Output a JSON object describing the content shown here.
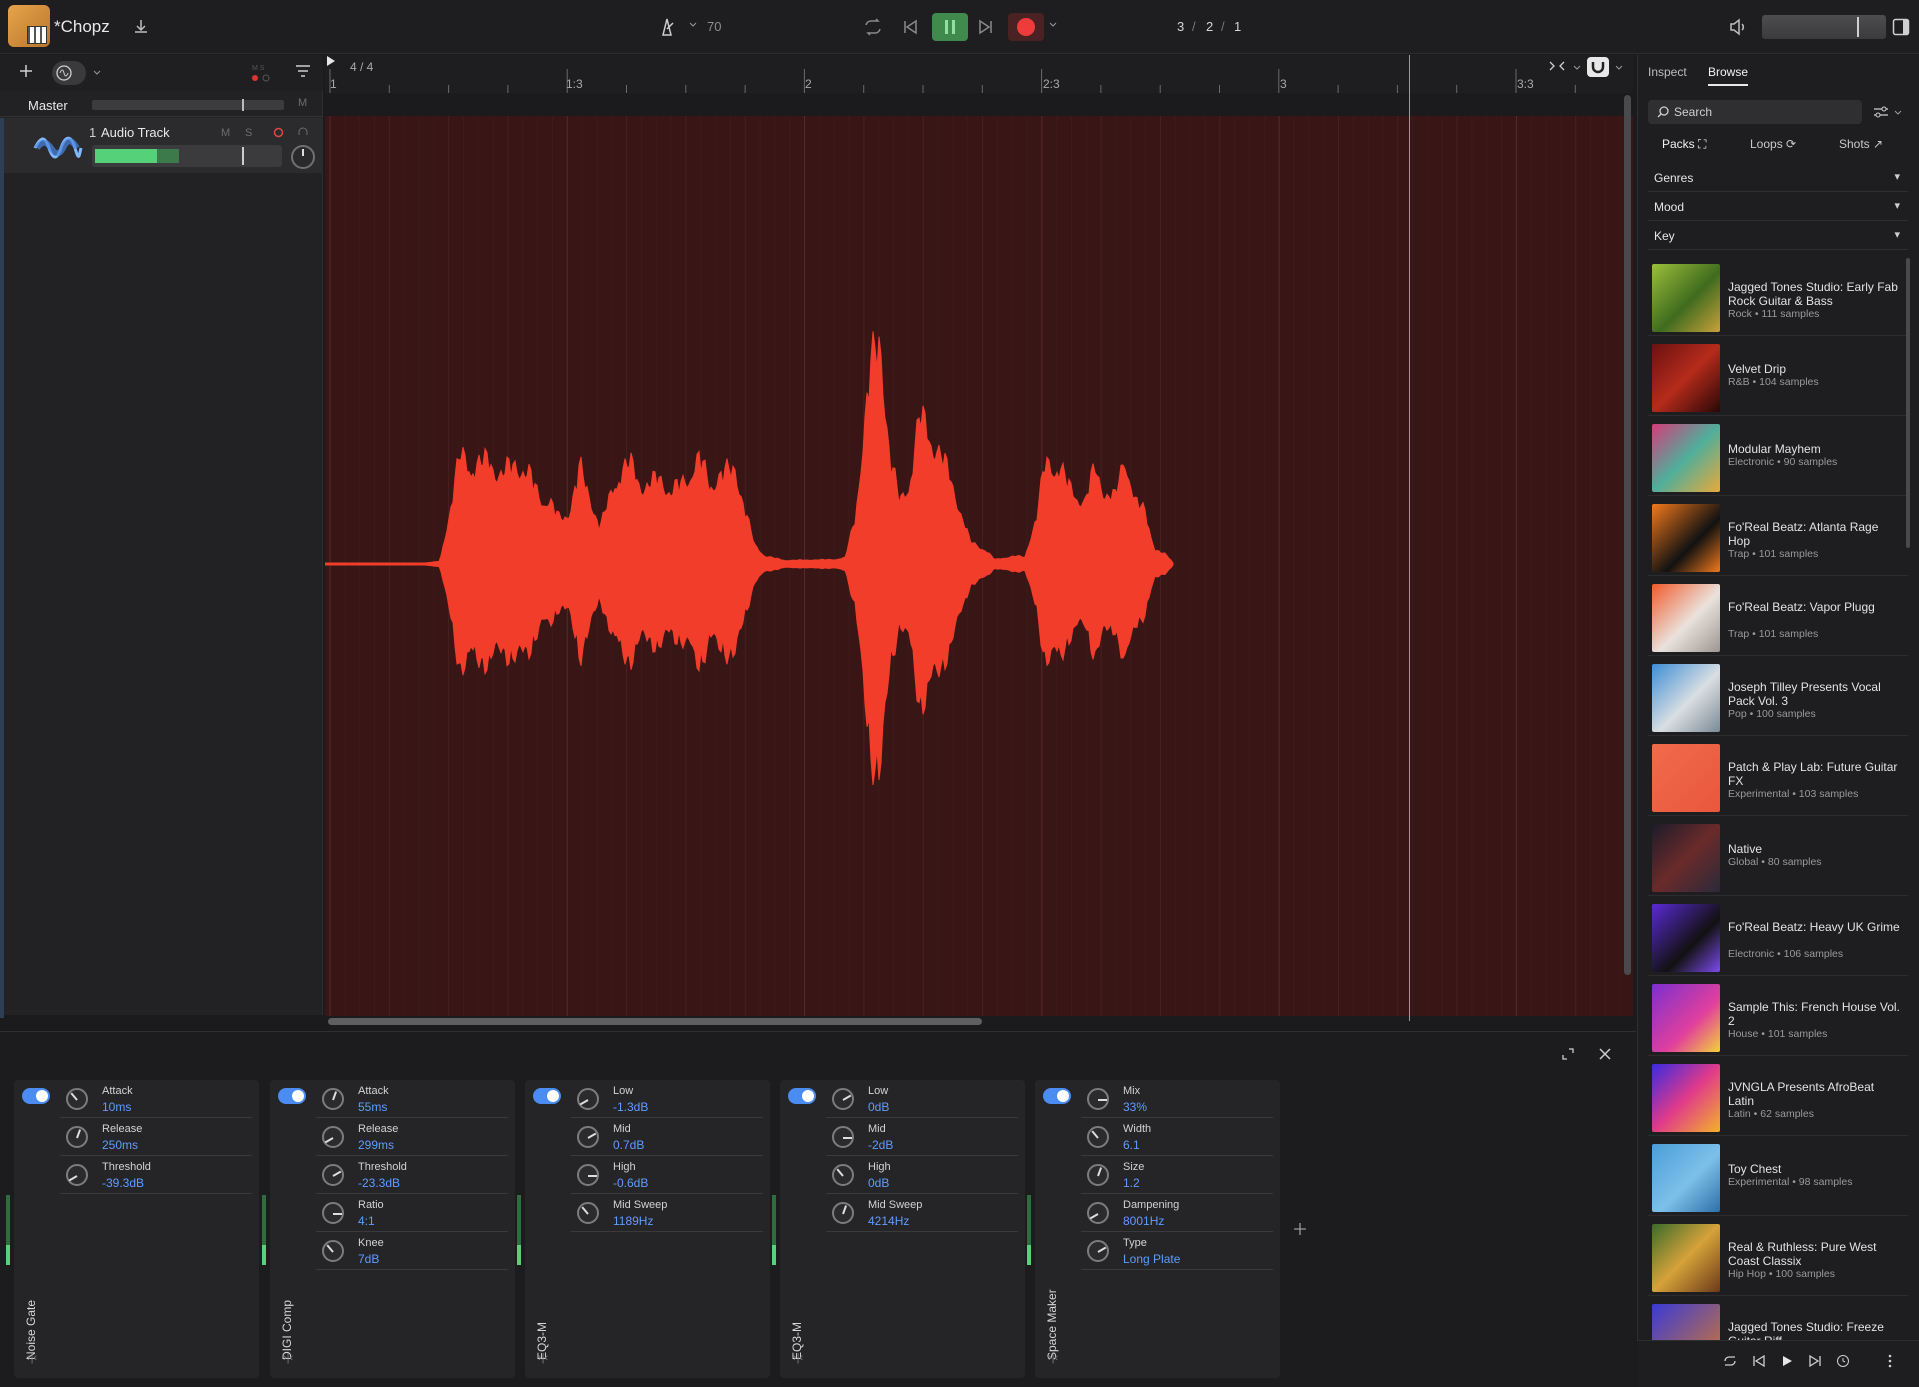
{
  "project": {
    "title": "*Chopz"
  },
  "transport": {
    "tempo": "70",
    "pos_bar": "3",
    "pos_beat": "2",
    "pos_sub": "1",
    "sep": "/"
  },
  "tracks": {
    "master": {
      "label": "Master",
      "m": "M"
    },
    "track1": {
      "number": "1",
      "name": "Audio Track",
      "m": "M",
      "s": "S"
    }
  },
  "ruler": {
    "time_sig": "4 / 4",
    "marks": [
      "1",
      "1:3",
      "2",
      "2:3",
      "3",
      "3:3"
    ]
  },
  "colors": {
    "accent": "#5f9cff",
    "waveform": "#f23d2a",
    "record": "#ef3b3b",
    "play": "#3f8a4c"
  },
  "plugins": [
    {
      "name": "Noise Gate",
      "params": [
        {
          "label": "Attack",
          "value": "10ms"
        },
        {
          "label": "Release",
          "value": "250ms"
        },
        {
          "label": "Threshold",
          "value": "-39.3dB"
        }
      ]
    },
    {
      "name": "DIGI Comp",
      "params": [
        {
          "label": "Attack",
          "value": "55ms"
        },
        {
          "label": "Release",
          "value": "299ms"
        },
        {
          "label": "Threshold",
          "value": "-23.3dB"
        },
        {
          "label": "Ratio",
          "value": "4:1"
        },
        {
          "label": "Knee",
          "value": "7dB"
        }
      ]
    },
    {
      "name": "EQ3-M",
      "params": [
        {
          "label": "Low",
          "value": "-1.3dB"
        },
        {
          "label": "Mid",
          "value": "0.7dB"
        },
        {
          "label": "High",
          "value": "-0.6dB"
        },
        {
          "label": "Mid Sweep",
          "value": "1189Hz"
        }
      ]
    },
    {
      "name": "EQ3-M",
      "params": [
        {
          "label": "Low",
          "value": "0dB"
        },
        {
          "label": "Mid",
          "value": "-2dB"
        },
        {
          "label": "High",
          "value": "0dB"
        },
        {
          "label": "Mid Sweep",
          "value": "4214Hz"
        }
      ]
    },
    {
      "name": "Space Maker",
      "params": [
        {
          "label": "Mix",
          "value": "33%"
        },
        {
          "label": "Width",
          "value": "6.1"
        },
        {
          "label": "Size",
          "value": "1.2"
        },
        {
          "label": "Dampening",
          "value": "8001Hz"
        },
        {
          "label": "Type",
          "value": "Long Plate"
        }
      ]
    }
  ],
  "browser": {
    "tabs": {
      "inspect": "Inspect",
      "browse": "Browse"
    },
    "search_placeholder": "Search",
    "subtabs": {
      "packs": "Packs",
      "loops": "Loops",
      "shots": "Shots"
    },
    "filters": [
      "Genres",
      "Mood",
      "Key"
    ],
    "packs": [
      {
        "title": "Jagged Tones Studio: Early Fab Rock Guitar & Bass",
        "meta": "Rock • 111 samples",
        "art": "linear-gradient(135deg,#9bbf3a,#3f6b1e 55%,#c9a13a)"
      },
      {
        "title": "Velvet Drip",
        "meta": "R&B • 104 samples",
        "art": "linear-gradient(135deg,#6b1111,#b52b1b 50%,#2a0707)"
      },
      {
        "title": "Modular Mayhem",
        "meta": "Electronic • 90 samples",
        "art": "linear-gradient(135deg,#d43d7a,#4fae9b 50%,#e8a93a)"
      },
      {
        "title": "Fo'Real Beatz: Atlanta Rage Hop",
        "meta": "Trap • 101 samples",
        "art": "linear-gradient(135deg,#f2791c,#111 60%,#f2791c)"
      },
      {
        "title": "Fo'Real Beatz: Vapor Plugg",
        "meta": "Trap • 101 samples",
        "art": "linear-gradient(135deg,#f25a2b,#e9e2dc 55%,#9e9591)"
      },
      {
        "title": "Joseph Tilley Presents Vocal Pack Vol. 3",
        "meta": "Pop • 100 samples",
        "art": "linear-gradient(135deg,#3d8ed6,#d9dee2 55%,#7a8a96)"
      },
      {
        "title": "Patch & Play Lab: Future Guitar FX",
        "meta": "Experimental • 103 samples",
        "art": "linear-gradient(135deg,#f06b4a,#e9573d)"
      },
      {
        "title": "Native",
        "meta": "Global • 80 samples",
        "art": "linear-gradient(135deg,#1c1c2a,#6b2a2a 50%,#2a2a3a)"
      },
      {
        "title": "Fo'Real Beatz: Heavy UK Grime",
        "meta": "Electronic • 106 samples",
        "art": "linear-gradient(135deg,#5a2ad6,#111 60%,#7d4bf0)"
      },
      {
        "title": "Sample This: French House Vol. 2",
        "meta": "House • 101 samples",
        "art": "linear-gradient(135deg,#7b2fd0,#e13f9c 60%,#f2d23a)"
      },
      {
        "title": "JVNGLA Presents AfroBeat Latin",
        "meta": "Latin • 62 samples",
        "art": "linear-gradient(135deg,#3a2ae0,#e03a8a 50%,#f3b22a)"
      },
      {
        "title": "Toy Chest",
        "meta": "Experimental • 98 samples",
        "art": "linear-gradient(135deg,#4a9ed8,#7cc0ea 55%,#2f6fa8)"
      },
      {
        "title": "Real & Ruthless: Pure West Coast Classix",
        "meta": "Hip Hop • 100 samples",
        "art": "linear-gradient(135deg,#3a6b2a,#d6a23a 50%,#6b3a1a)"
      },
      {
        "title": "Jagged Tones Studio: Freeze Guitar Riff",
        "meta": "",
        "art": "linear-gradient(135deg,#3a3ad6,#d67a2a)"
      }
    ]
  }
}
